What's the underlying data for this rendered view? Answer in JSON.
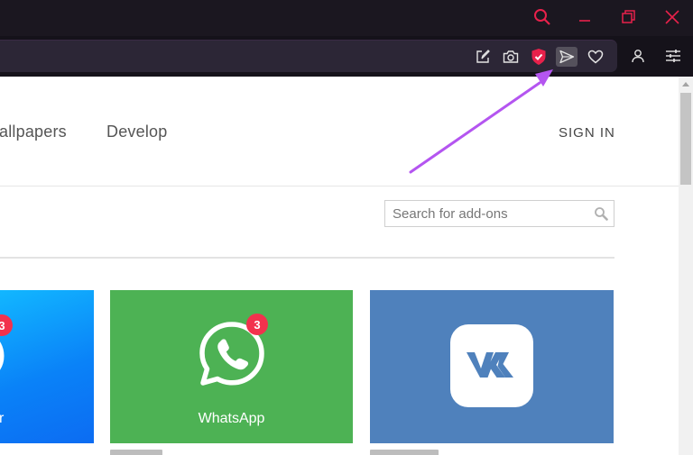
{
  "window": {
    "controls": [
      "search-icon",
      "minimize-icon",
      "restore-icon",
      "close-icon"
    ]
  },
  "toolbar": {
    "icons": [
      "snapshot-edit-icon",
      "camera-icon",
      "vpn-shield-icon",
      "send-icon",
      "heart-icon",
      "profile-icon",
      "easy-setup-icon"
    ],
    "accent_color": "#e8214b"
  },
  "site_nav": {
    "wallpapers_label": "allpapers",
    "develop_label": "Develop",
    "signin_label": "SIGN IN"
  },
  "search": {
    "placeholder": "Search for add-ons"
  },
  "cards": {
    "messenger": {
      "label": "r",
      "badge": "3",
      "color": "#0a8dff"
    },
    "whatsapp": {
      "label": "WhatsApp",
      "badge": "3",
      "color": "#4db254"
    },
    "vk": {
      "label": "",
      "color": "#4f81bc"
    }
  },
  "annotation": {
    "color": "#b455f0",
    "target": "send-icon"
  }
}
